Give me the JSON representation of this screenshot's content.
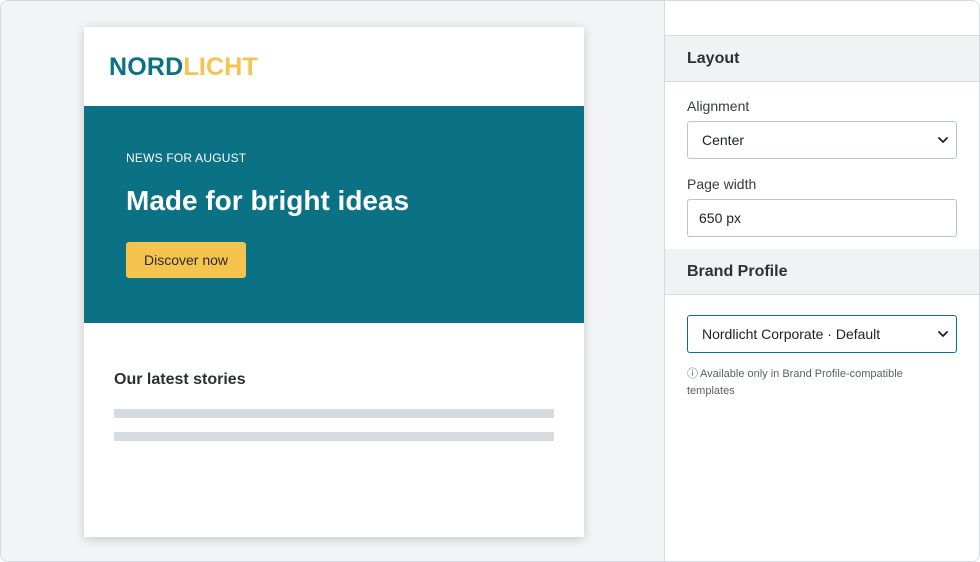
{
  "colors": {
    "brand_primary": "#0b7285",
    "brand_accent": "#f5c44e",
    "hero_bg": "#0b7285",
    "cta_bg": "#f5c44e"
  },
  "email": {
    "logo_part1": "NORD",
    "logo_part2": "LICHT",
    "hero": {
      "eyebrow": "NEWS FOR AUGUST",
      "headline": "Made for bright ideas",
      "cta_label": "Discover now"
    },
    "stories": {
      "title": "Our latest stories"
    }
  },
  "panel": {
    "layout": {
      "title": "Layout",
      "alignment_label": "Alignment",
      "alignment_value": "Center",
      "page_width_label": "Page width",
      "page_width_value": "650 px"
    },
    "brand_profile": {
      "title": "Brand Profile",
      "selected": "Nordlicht Corporate · Default",
      "note": "Available only in Brand Profile-compatible templates",
      "note_icon": "info-icon"
    }
  }
}
